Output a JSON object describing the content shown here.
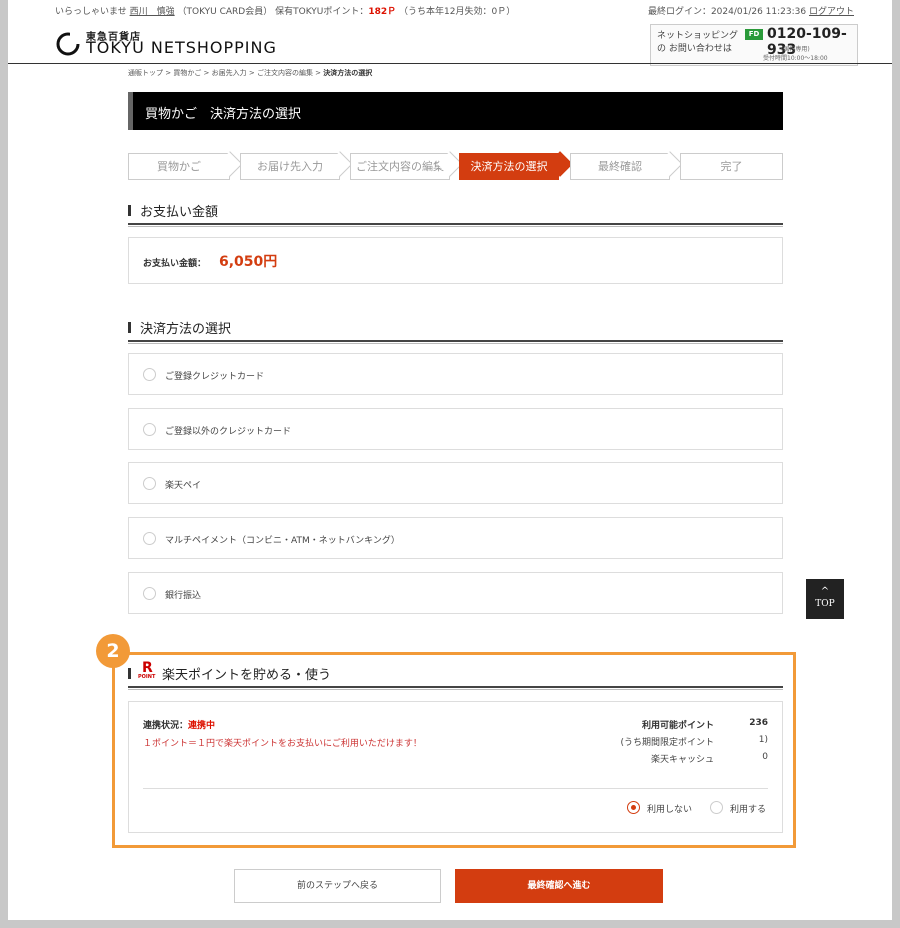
{
  "header": {
    "greeting_prefix": "いらっしゃいませ",
    "user_name": "西川　慎強",
    "member_type": "（TOKYU CARD会員）",
    "points_label": "保有TOKYUポイント：",
    "points_value": "182Ｐ",
    "points_note": "（うち本年12月失効：0Ｐ）",
    "last_login": "最終ログイン：2024/01/26 11:23:36",
    "logout": "ログアウト",
    "logo_dept": "東急百貨店",
    "logo_brand": "TOKYU NETSHOPPING",
    "contact_label": "ネットショッピングの お問い合わせは",
    "free_dial_icon": "FD",
    "tel": "0120-109-933",
    "tel_note": "(国内専用)",
    "hours": "受付時間10:00〜18:00"
  },
  "breadcrumb": {
    "path": "通販トップ > 買物かご > お届先入力 > ご注文内容の編集 > ",
    "current": "決済方法の選択"
  },
  "page_title": "買物かご　決済方法の選択",
  "steps": [
    "買物かご",
    "お届け先入力",
    "ご注文内容の編集",
    "決済方法の選択",
    "最終確認",
    "完了"
  ],
  "payment_amount": {
    "heading": "お支払い金額",
    "label": "お支払い金額：",
    "value": "6,050円"
  },
  "payment_method": {
    "heading": "決済方法の選択",
    "options": [
      "ご登録クレジットカード",
      "ご登録以外のクレジットカード",
      "楽天ペイ",
      "マルチペイメント（コンビニ・ATM・ネットバンキング）",
      "銀行振込"
    ]
  },
  "rakuten": {
    "badge": "2",
    "logo_r": "R",
    "logo_point": "POINT",
    "heading": "楽天ポイントを貯める・使う",
    "status_label": "連携状況：",
    "status_value": "連携中",
    "note": "１ポイント＝１円で楽天ポイントをお支払いにご利用いただけます！",
    "available_label": "利用可能ポイント",
    "available_value": "236",
    "limited_label": "(うち期間限定ポイント",
    "limited_value": "1)",
    "cash_label": "楽天キャッシュ",
    "cash_value": "0",
    "use_no": "利用しない",
    "use_yes": "利用する",
    "selected": "利用しない"
  },
  "buttons": {
    "prev": "前のステップへ戻る",
    "next": "最終確認へ進む",
    "top": "TOP"
  },
  "colors": {
    "accent": "#d33d10",
    "highlight": "#f29a38"
  }
}
